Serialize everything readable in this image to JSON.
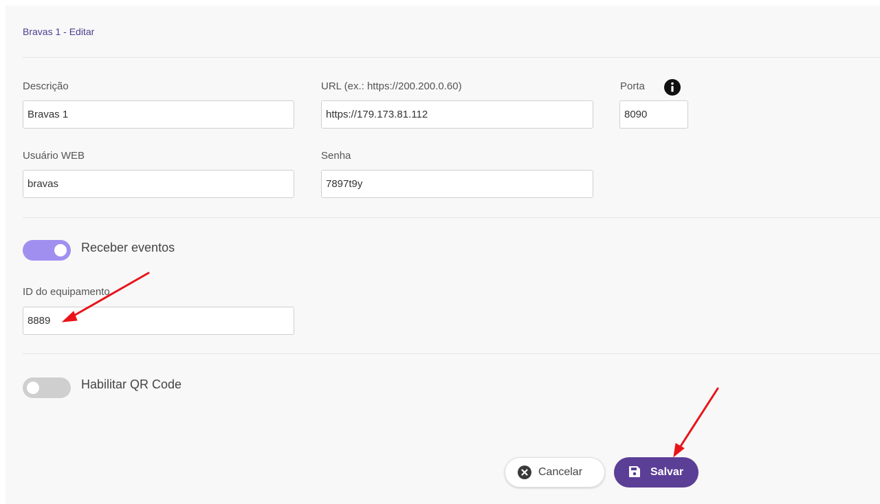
{
  "header": {
    "title": "Bravas 1 - Editar"
  },
  "form": {
    "descricao": {
      "label": "Descrição",
      "value": "Bravas 1"
    },
    "url": {
      "label": "URL (ex.: https://200.200.0.60)",
      "value": "https://179.173.81.112"
    },
    "porta": {
      "label": "Porta",
      "value": "8090",
      "info_icon": "info-icon"
    },
    "usuario": {
      "label": "Usuário WEB",
      "value": "bravas"
    },
    "senha": {
      "label": "Senha",
      "value": "7897t9y"
    },
    "receber_eventos": {
      "label": "Receber eventos",
      "enabled": true
    },
    "id_equipamento": {
      "label": "ID do equipamento",
      "value": "8889"
    },
    "qr_code": {
      "label": "Habilitar QR Code",
      "enabled": false
    }
  },
  "actions": {
    "cancel_label": "Cancelar",
    "cancel_icon": "close-circle-icon",
    "save_label": "Salvar",
    "save_icon": "floppy-disk-icon"
  },
  "colors": {
    "accent": "#5b3e96",
    "toggle_on": "#a18ff0",
    "annotation_arrow": "#e8141a"
  }
}
